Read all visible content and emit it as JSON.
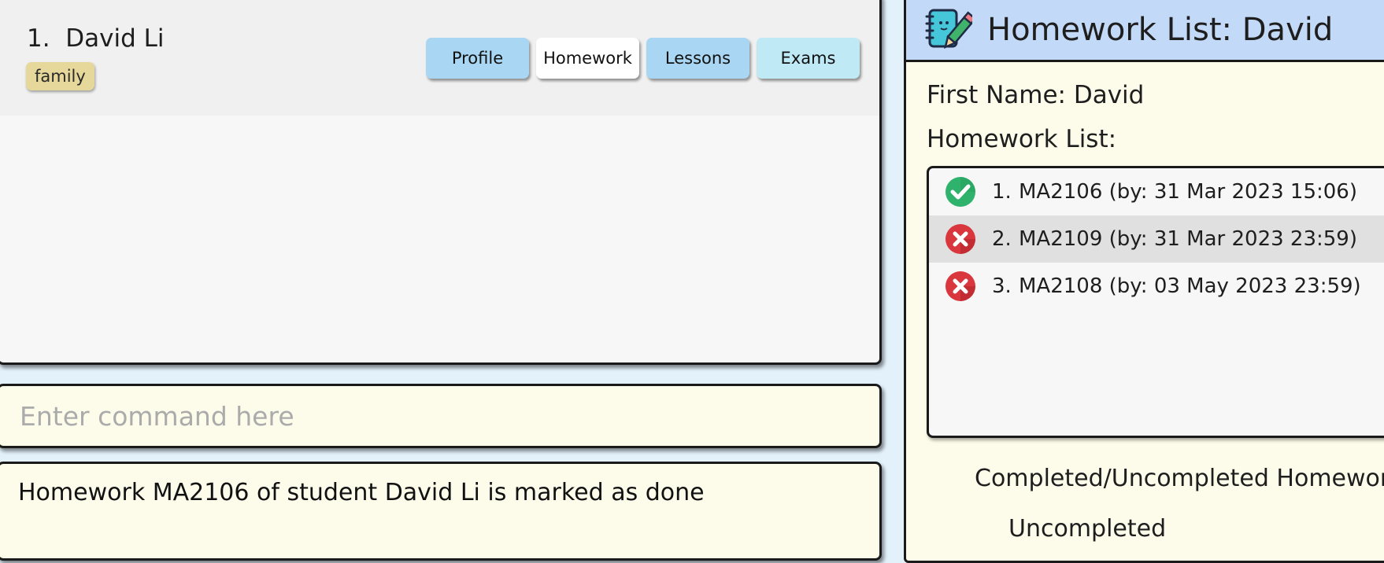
{
  "student_list": {
    "students": [
      {
        "index": "1.",
        "name": "David Li",
        "tags": [
          "family"
        ],
        "tabs": {
          "profile": "Profile",
          "homework": "Homework",
          "lessons": "Lessons",
          "exams": "Exams"
        },
        "active_tab": "homework"
      }
    ]
  },
  "command_box": {
    "placeholder": "Enter command here",
    "value": ""
  },
  "result_display": {
    "message": "Homework MA2106 of student David Li is marked as done"
  },
  "homework_panel": {
    "title": "Homework List: David",
    "header_icon": "notebook-pencil-icon",
    "first_name_line": "First Name: David",
    "list_label": "Homework List:",
    "items": [
      {
        "index": "1.",
        "text": "MA2106 (by: 31 Mar 2023 15:06)",
        "status": "done",
        "status_icon": "check-circle-icon"
      },
      {
        "index": "2.",
        "text": "MA2109 (by: 31 Mar 2023 23:59)",
        "status": "not-done",
        "status_icon": "cross-circle-icon"
      },
      {
        "index": "3.",
        "text": "MA2108 (by: 03 May 2023 23:59)",
        "status": "not-done",
        "status_icon": "cross-circle-icon"
      }
    ],
    "chart_title": "Completed/Uncompleted Homework",
    "chart_legend_partial": "Uncompleted"
  },
  "colors": {
    "background": "#e3f1fb",
    "panel_border": "#1a1a1a",
    "tag": "#e6d79b",
    "tab_blue": "#a9d6f2",
    "tab_active": "#ffffff",
    "tab_exams": "#bfe9f5",
    "header_blue": "#c3d9f8",
    "cream": "#fdfbe9",
    "done_green": "#2fb36c",
    "not_done_red": "#d9363e"
  }
}
